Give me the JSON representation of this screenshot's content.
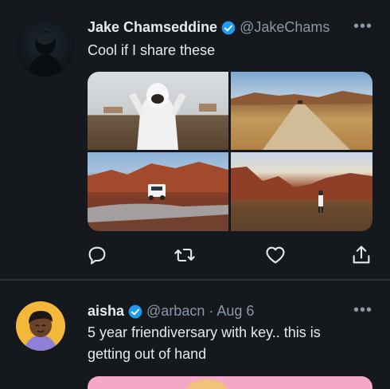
{
  "tweets": [
    {
      "name": "Jake Chamseddine",
      "handle": "@JakeChams",
      "text": "Cool if I share these",
      "verified": true
    },
    {
      "name": "aisha",
      "handle": "@arbacn · Aug 6",
      "text": "5 year friendiversary with key.. this is getting out of hand",
      "verified": true
    }
  ],
  "icons": {
    "more": "more-options-icon",
    "reply": "reply-icon",
    "retweet": "retweet-icon",
    "like": "like-icon",
    "share": "share-icon",
    "verified": "verified-badge-icon"
  },
  "colors": {
    "background": "#15181c",
    "text": "#e7e9ea",
    "secondary": "#8b98a5",
    "verified": "#1d9bf0"
  }
}
